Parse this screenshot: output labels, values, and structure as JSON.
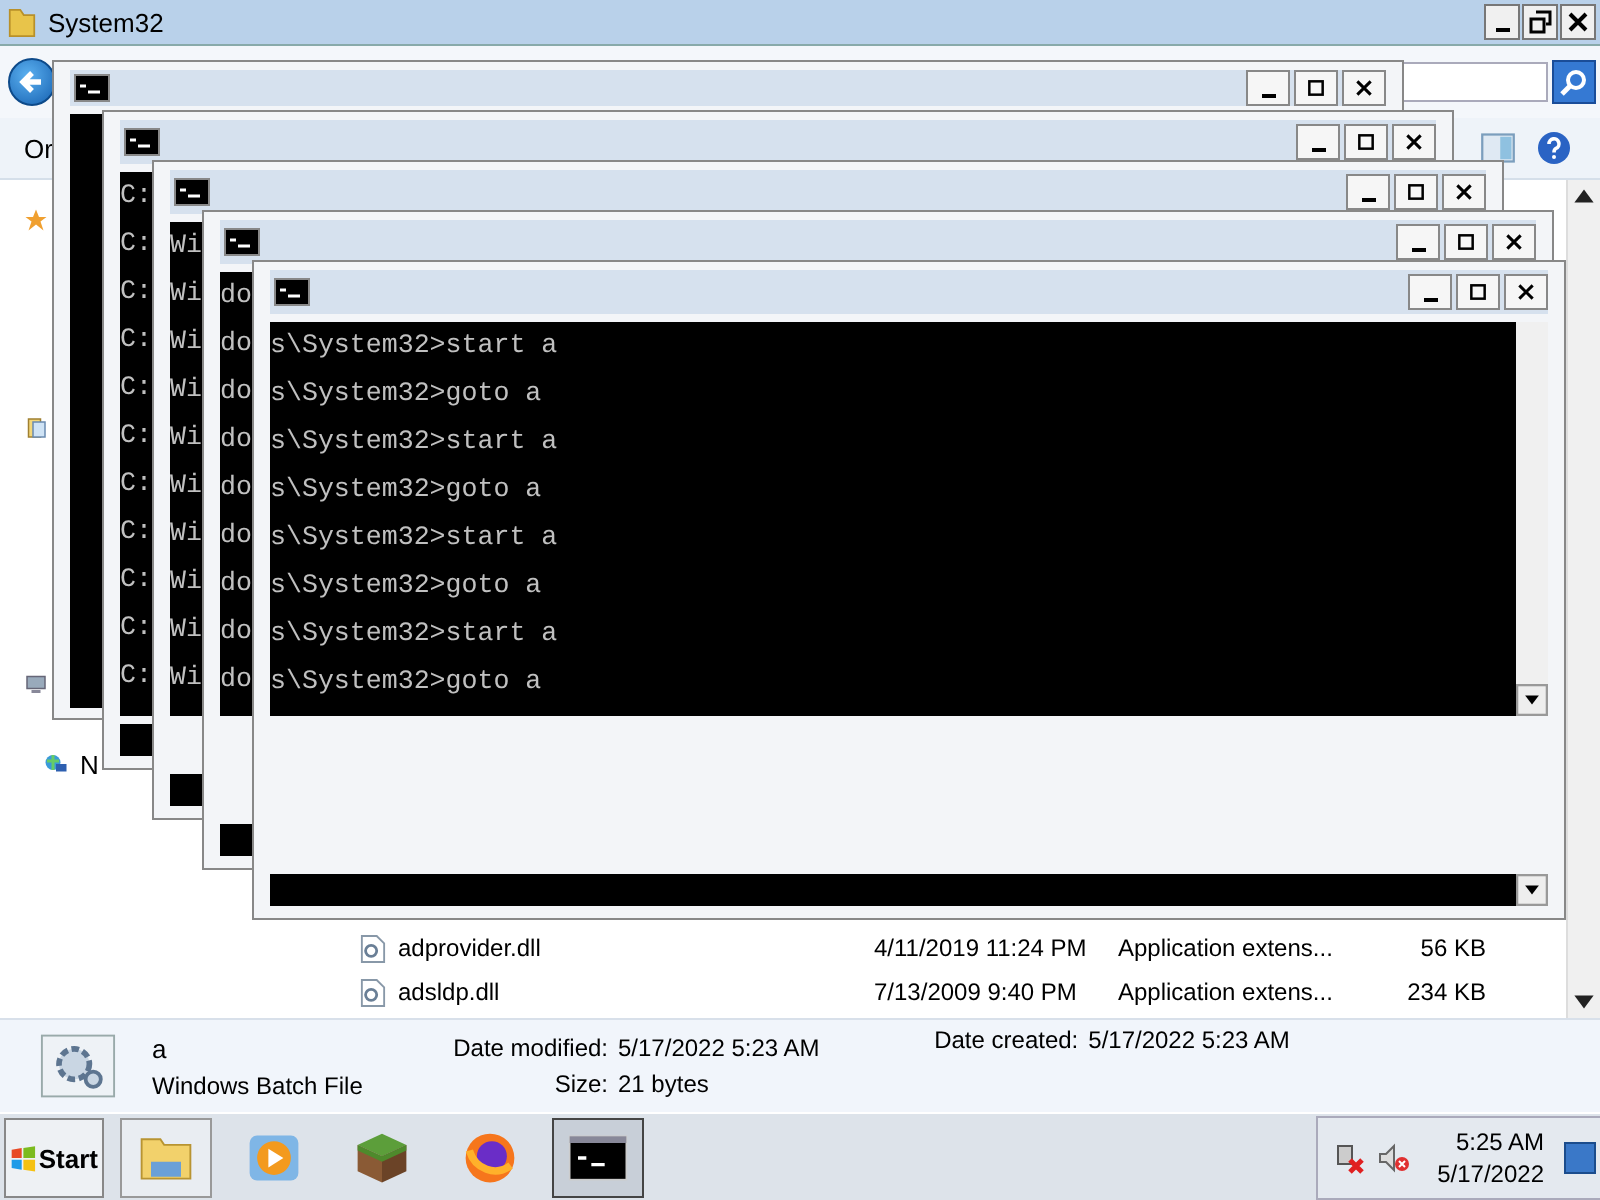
{
  "explorer": {
    "title": "System32",
    "toolbar": {
      "organize": "Or"
    },
    "navigation": [
      {
        "kind": "favorites"
      },
      {
        "kind": "libraries"
      },
      {
        "kind": "computer"
      },
      {
        "kind": "network",
        "label": "N"
      }
    ],
    "files": [
      {
        "name": "adprovider.dll",
        "modified": "4/11/2019 11:24 PM",
        "type": "Application extens...",
        "size": "56 KB"
      },
      {
        "name": "adsldp.dll",
        "modified": "7/13/2009 9:40 PM",
        "type": "Application extens...",
        "size": "234 KB"
      }
    ]
  },
  "details": {
    "name": "a",
    "type": "Windows Batch File",
    "modified_label": "Date modified:",
    "modified": "5/17/2022 5:23 AM",
    "size_label": "Size:",
    "size": "21 bytes",
    "created_label": "Date created:",
    "created": "5/17/2022 5:23 AM"
  },
  "consoles": [
    {
      "kind": "console"
    },
    {
      "kind": "console",
      "lines": [
        "C:",
        "C:",
        "C:",
        "C:",
        "C:",
        "C:",
        "C:",
        "C:",
        "C:",
        "C:",
        "C:"
      ]
    },
    {
      "kind": "console",
      "lines": [
        "Wi",
        "Wi",
        "Wi",
        "Wi",
        "Wi",
        "Wi",
        "Wi",
        "Wi",
        "Wi",
        "Wi"
      ]
    },
    {
      "kind": "console",
      "lines": [
        "do",
        "do",
        "do",
        "do",
        "do",
        "do",
        "do",
        "do",
        "do"
      ]
    },
    {
      "kind": "console",
      "lines": [
        "s\\System32>start a",
        "s\\System32>goto a",
        "s\\System32>start a",
        "s\\System32>goto a",
        "s\\System32>start a",
        "s\\System32>goto a",
        "s\\System32>start a",
        "s\\System32>goto a"
      ]
    }
  ],
  "taskbar": {
    "start": "Start",
    "apps": [
      {
        "kind": "explorer"
      },
      {
        "kind": "media"
      },
      {
        "kind": "block"
      },
      {
        "kind": "browser"
      },
      {
        "kind": "console"
      }
    ],
    "time": "5:25 AM",
    "date": "5/17/2022"
  }
}
